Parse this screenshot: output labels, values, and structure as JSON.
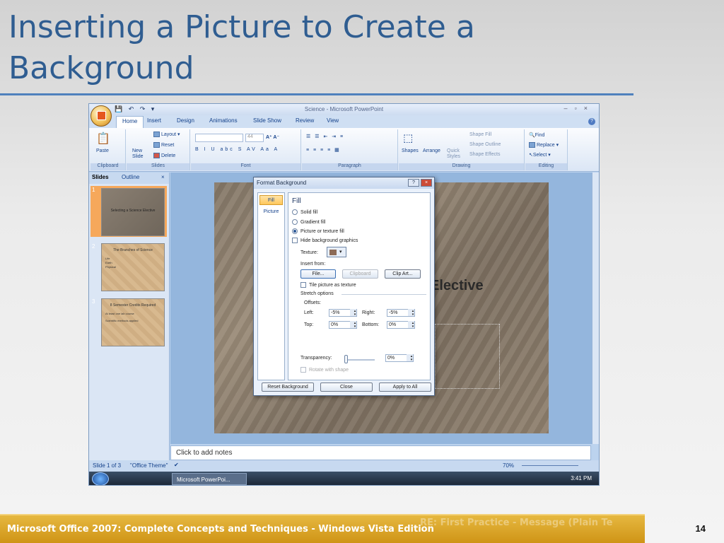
{
  "slide": {
    "title": "Inserting a Picture to Create a Background",
    "footer": "Microsoft Office 2007: Complete Concepts and Techniques - Windows Vista Edition",
    "footer_ghost": "RE: First Practice - Message (Plain Te",
    "page_number": "14"
  },
  "app": {
    "window_title": "Science - Microsoft PowerPoint",
    "tabs": [
      "Home",
      "Insert",
      "Design",
      "Animations",
      "Slide Show",
      "Review",
      "View"
    ],
    "active_tab": "Home"
  },
  "ribbon": {
    "clipboard": {
      "paste": "Paste",
      "label": "Clipboard"
    },
    "slides": {
      "new_slide": "New Slide",
      "layout": "Layout",
      "reset": "Reset",
      "delete": "Delete",
      "label": "Slides"
    },
    "font": {
      "size": "44",
      "label": "Font"
    },
    "paragraph": {
      "label": "Paragraph"
    },
    "drawing": {
      "shapes": "Shapes",
      "arrange": "Arrange",
      "quick_styles": "Quick Styles",
      "shape_fill": "Shape Fill",
      "shape_outline": "Shape Outline",
      "shape_effects": "Shape Effects",
      "label": "Drawing"
    },
    "editing": {
      "find": "Find",
      "replace": "Replace",
      "select": "Select",
      "label": "Editing"
    }
  },
  "left_pane": {
    "tabs": [
      "Slides",
      "Outline"
    ],
    "thumbnails": [
      {
        "num": "1",
        "title": "Selecting a Science Elective",
        "bullets": []
      },
      {
        "num": "2",
        "title": "The Branches of Science",
        "bullets": [
          "Life",
          "Earth",
          "Physical"
        ]
      },
      {
        "num": "3",
        "title": "8 Semester Credits Required",
        "bullets": [
          "At least one lab course",
          "Scientific methods applied"
        ]
      }
    ]
  },
  "main": {
    "slide_text": "Elective",
    "notes_placeholder": "Click to add notes"
  },
  "status": {
    "slide_info": "Slide 1 of 3",
    "theme": "\"Office Theme\"",
    "zoom": "70%"
  },
  "taskbar": {
    "item": "Microsoft PowerPoi...",
    "clock": "3:41 PM"
  },
  "dialog": {
    "title": "Format Background",
    "nav": [
      "Fill",
      "Picture"
    ],
    "section": "Fill",
    "fill_options": [
      "Solid fill",
      "Gradient fill",
      "Picture or texture fill"
    ],
    "selected_fill": "Picture or texture fill",
    "hide_bg": "Hide background graphics",
    "texture_label": "Texture:",
    "insert_from": "Insert from:",
    "file_btn": "File...",
    "clipboard_btn": "Clipboard",
    "clipart_btn": "Clip Art...",
    "tile": "Tile picture as texture",
    "stretch": "Stretch options",
    "offsets": "Offsets:",
    "left_label": "Left:",
    "left_val": "-5%",
    "right_label": "Right:",
    "right_val": "-5%",
    "top_label": "Top:",
    "top_val": "0%",
    "bottom_label": "Bottom:",
    "bottom_val": "0%",
    "transparency_label": "Transparency:",
    "transparency_val": "0%",
    "rotate": "Rotate with shape",
    "reset_btn": "Reset Background",
    "close_btn": "Close",
    "apply_btn": "Apply to All"
  }
}
